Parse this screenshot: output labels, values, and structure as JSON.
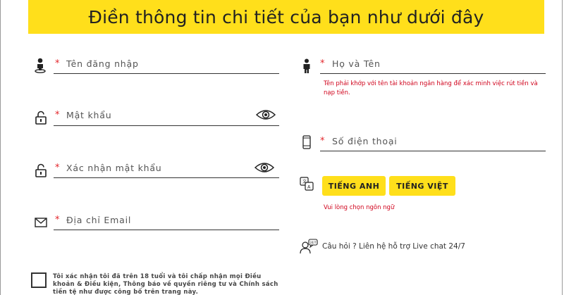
{
  "banner": {
    "title": "Điền thông tin chi tiết của bạn như dưới đây"
  },
  "form": {
    "required_mark": "*",
    "username": {
      "placeholder": "Tên đăng nhập",
      "icon": "user-pin-icon"
    },
    "password": {
      "placeholder": "Mật khẩu",
      "icon": "lock-icon"
    },
    "confirm_password": {
      "placeholder": "Xác nhận mật khẩu",
      "icon": "lock-icon"
    },
    "email": {
      "placeholder": "Địa chỉ Email",
      "icon": "envelope-icon"
    },
    "full_name": {
      "placeholder": "Họ và Tên",
      "icon": "person-icon",
      "hint": "Tên phải khớp với tên tài khoản ngân hàng để xác minh việc rút tiền và nạp tiền."
    },
    "phone": {
      "placeholder": "Số điện thoại",
      "icon": "phone-icon"
    }
  },
  "language": {
    "icon": "translate-icon",
    "options": [
      "TIẾNG ANH",
      "TIẾNG VIỆT"
    ],
    "hint": "Vui lòng chọn ngôn ngữ"
  },
  "support": {
    "icon": "chat-support-icon",
    "text": "Câu hỏi ? Liên hệ hỗ trợ Live chat 24/7"
  },
  "terms": {
    "text": "Tôi xác nhận tôi đã trên 18 tuổi và tôi chấp nhận mọi Điều khoản & Điều kiện, Thông báo về quyền riêng tư và Chính sách tiền tệ như được công bố trên trang này."
  },
  "colors": {
    "accent": "#ffdf1b",
    "error": "#d0021b",
    "required": "#e3262b"
  }
}
